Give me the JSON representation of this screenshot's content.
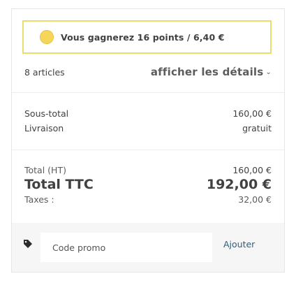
{
  "loyalty": {
    "message": "Vous gagnerez 16 points / 6,40 €",
    "coin_color": "#f5d65a",
    "border_color": "#e8de6a"
  },
  "summary": {
    "items_count": "8 articles",
    "details_link": "afficher les détails",
    "details_chevron": "⌄"
  },
  "subtotals": [
    {
      "label": "Sous-total",
      "value": "160,00 €"
    },
    {
      "label": "Livraison",
      "value": "gratuit"
    }
  ],
  "totals": {
    "ht_label": "Total (HT)",
    "ht_value": "160,00 €",
    "ttc_label": "Total TTC",
    "ttc_value": "192,00 €",
    "tax_label": "Taxes :",
    "tax_value": "32,00 €"
  },
  "promo": {
    "icon": "tag-icon",
    "placeholder": "Code promo",
    "value": "",
    "button_label": "Ajouter",
    "button_color": "#2a5f7f"
  }
}
